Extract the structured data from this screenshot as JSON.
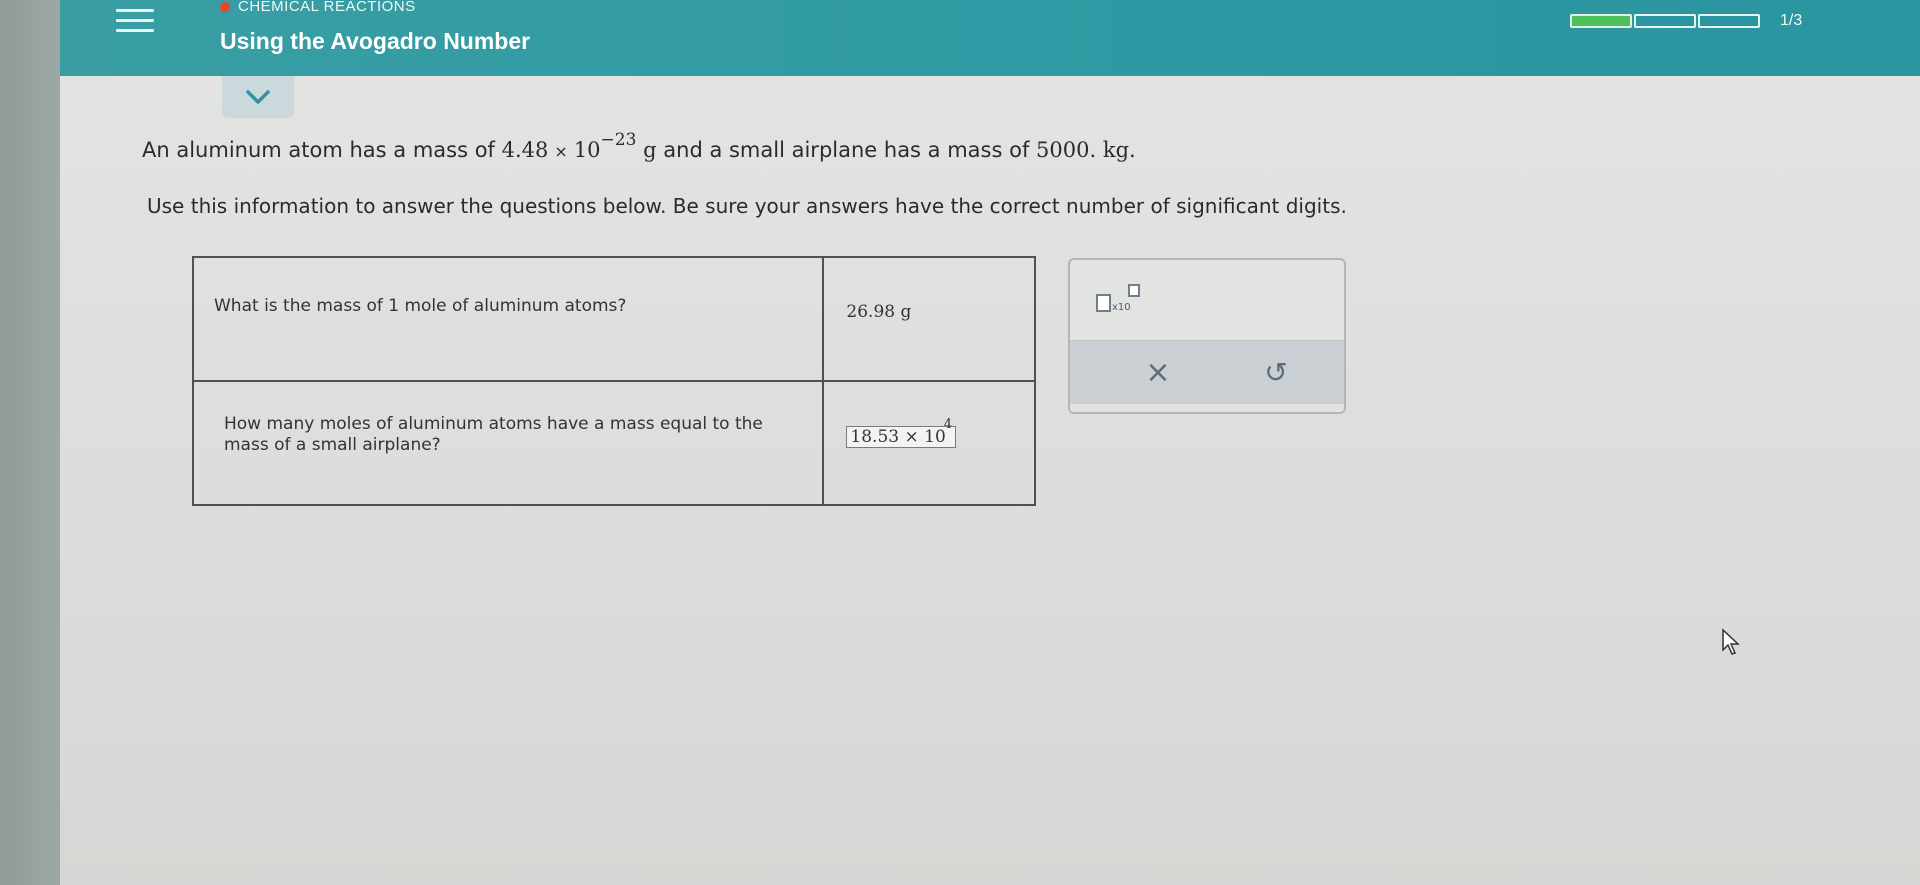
{
  "header": {
    "category": "CHEMICAL REACTIONS",
    "title": "Using the Avogadro Number",
    "progress_count": "1/3",
    "progress_fraction": 0.33,
    "colors": {
      "bar": "#2f9aa3",
      "progress_fill": "#4fc05b",
      "dot": "#e4472e"
    }
  },
  "problem": {
    "line1_pre": "An aluminum atom has a mass of",
    "atom_mass_mantissa": "4.48",
    "times": "×",
    "base": "10",
    "atom_mass_exponent": "−23",
    "atom_mass_unit": "g",
    "line1_mid": "and a small airplane has a mass of",
    "plane_mass": "5000.",
    "plane_mass_unit": "kg",
    "line1_end": ".",
    "instructions": "Use this information to answer the questions below. Be sure your answers have the correct number of significant digits."
  },
  "table": {
    "q1": "What is the mass of 1 mole of aluminum atoms?",
    "a1": "26.98 g",
    "q2": "How many moles of aluminum atoms have a mass equal to the mass of a small airplane?",
    "a2_mantissa": "18.53",
    "a2_times": "×",
    "a2_base": "10",
    "a2_exponent": "4"
  },
  "tools": {
    "sci_notation_label": "x10",
    "clear_icon": "close-icon",
    "clear_symbol": "×",
    "undo_icon": "undo-icon",
    "undo_symbol": "↺"
  }
}
